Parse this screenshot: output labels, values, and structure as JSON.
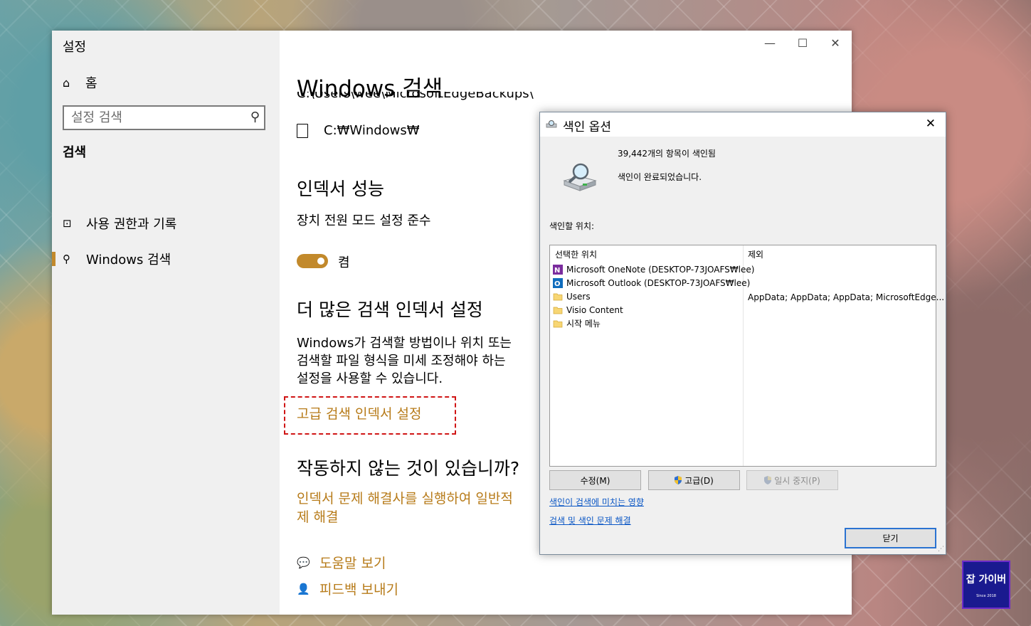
{
  "settings": {
    "app_title": "설정",
    "home_label": "홈",
    "search_placeholder": "설정 검색",
    "section_heading": "검색",
    "nav": [
      {
        "label": "사용 권한과 기록"
      },
      {
        "label": "Windows 검색"
      }
    ]
  },
  "window_controls": {
    "minimize": "—",
    "maximize": "☐",
    "close": "✕"
  },
  "content": {
    "page_title": "Windows 검색",
    "path_partial": "C:\\Users\\wee\\MicrosoftEdgeBackups\\",
    "path_windows": "C:₩Windows₩",
    "indexer_perf_heading": "인덱서 성능",
    "power_mode_label": "장치 전원 모드 설정 준수",
    "toggle_state": "켬",
    "more_settings_heading": "더 많은 검색 인덱서 설정",
    "desc_line1": "Windows가 검색할 방법이나 위치 또는",
    "desc_line2": "검색할 파일 형식을 미세 조정해야 하는",
    "desc_line3": "설정을 사용할 수 있습니다.",
    "advanced_link": "고급 검색 인덱서 설정",
    "trouble_heading": "작동하지 않는 것이 있습니까?",
    "trouble_link_line1": "인덱서 문제 해결사를 실행하여 일반적",
    "trouble_link_line2": "제 해결",
    "help_link": "도움말 보기",
    "feedback_link": "피드백 보내기"
  },
  "dialog": {
    "title": "색인 옵션",
    "close": "✕",
    "items_indexed": "39,442개의 항목이 색인됨",
    "status": "색인이 완료되었습니다.",
    "locations_label": "색인할 위치:",
    "col_selected": "선택한 위치",
    "col_exclude": "제외",
    "locations": [
      {
        "name": "Microsoft OneNote (DESKTOP-73JOAFS₩lee)",
        "icon": "onenote-icon"
      },
      {
        "name": "Microsoft Outlook (DESKTOP-73JOAFS₩lee)",
        "icon": "outlook-icon"
      },
      {
        "name": "Users",
        "icon": "folder-icon"
      },
      {
        "name": "Visio Content",
        "icon": "folder-icon"
      },
      {
        "name": "시작 메뉴",
        "icon": "folder-icon"
      }
    ],
    "users_exclude": "AppData; AppData; AppData; MicrosoftEdge...",
    "btn_modify": "수정(M)",
    "btn_advanced": "고급(D)",
    "btn_pause": "일시 중지(P)",
    "link_effect": "색인이 검색에 미치는 영향",
    "link_troubleshoot": "검색 및 색인 문제 해결",
    "btn_close": "닫기"
  },
  "colors": {
    "accent": "#c2892b",
    "link": "#b77b19",
    "dialog_link": "#0b57c5",
    "highlight_box": "#d01515"
  }
}
